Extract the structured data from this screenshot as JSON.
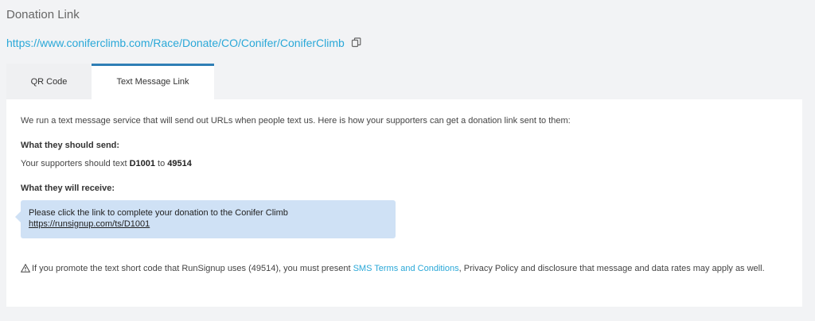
{
  "header": {
    "title": "Donation Link",
    "url": "https://www.coniferclimb.com/Race/Donate/CO/Conifer/ConiferClimb",
    "copy_icon": "copy-icon"
  },
  "tabs": [
    {
      "label": "QR Code",
      "active": false
    },
    {
      "label": "Text Message Link",
      "active": true
    }
  ],
  "panel": {
    "intro": "We run a text message service that will send out URLs when people text us. Here is how your supporters can get a donation link sent to them:",
    "send_heading": "What they should send:",
    "send_prefix": "Your supporters should text ",
    "send_code": "D1001",
    "send_middle": " to ",
    "send_number": "49514",
    "receive_heading": "What they will receive:",
    "message": {
      "text": "Please click the link to complete your donation to the Conifer Climb",
      "link": "https://runsignup.com/ts/D1001"
    },
    "notice": {
      "icon": "warning-icon",
      "before": "If you promote the text short code that RunSignup uses (49514), you must present ",
      "link_label": "SMS Terms and Conditions",
      "after": ", Privacy Policy and disclosure that message and data rates may apply as well."
    }
  },
  "colors": {
    "link": "#2aa8d8",
    "active_tab_border": "#2f7fb5",
    "bubble": "#cfe1f5",
    "background": "#f2f3f5"
  }
}
